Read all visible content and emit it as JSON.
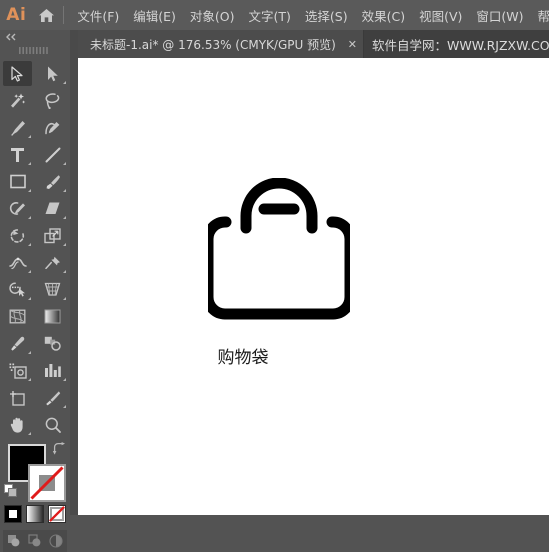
{
  "app": {
    "logo_text": "Ai",
    "home_icon": "home-icon"
  },
  "menubar": {
    "items": [
      {
        "label": "文件(F)"
      },
      {
        "label": "编辑(E)"
      },
      {
        "label": "对象(O)"
      },
      {
        "label": "文字(T)"
      },
      {
        "label": "选择(S)"
      },
      {
        "label": "效果(C)"
      },
      {
        "label": "视图(V)"
      },
      {
        "label": "窗口(W)"
      },
      {
        "label": "帮助"
      }
    ]
  },
  "tabbar": {
    "document_tab": {
      "title": "未标题-1.ai* @ 176.53% (CMYK/GPU 预览)",
      "close_label": "✕"
    },
    "watermark": "软件自学网：WWW.RJZXW.COM"
  },
  "toolbar": {
    "collapse_label": "◀◀",
    "tools": [
      {
        "name": "selection-tool",
        "selected": true,
        "corner": false
      },
      {
        "name": "direct-selection-tool",
        "selected": false,
        "corner": true
      },
      {
        "name": "magic-wand-tool",
        "selected": false,
        "corner": false
      },
      {
        "name": "lasso-tool",
        "selected": false,
        "corner": false
      },
      {
        "name": "pen-tool",
        "selected": false,
        "corner": true
      },
      {
        "name": "curvature-tool",
        "selected": false,
        "corner": false
      },
      {
        "name": "type-tool",
        "selected": false,
        "corner": true
      },
      {
        "name": "line-segment-tool",
        "selected": false,
        "corner": true
      },
      {
        "name": "rectangle-tool",
        "selected": false,
        "corner": true
      },
      {
        "name": "paintbrush-tool",
        "selected": false,
        "corner": true
      },
      {
        "name": "shaper-tool",
        "selected": false,
        "corner": true
      },
      {
        "name": "eraser-tool",
        "selected": false,
        "corner": true
      },
      {
        "name": "rotate-tool",
        "selected": false,
        "corner": true
      },
      {
        "name": "scale-tool",
        "selected": false,
        "corner": true
      },
      {
        "name": "width-tool",
        "selected": false,
        "corner": true
      },
      {
        "name": "free-transform-tool",
        "selected": false,
        "corner": true
      },
      {
        "name": "shape-builder-tool",
        "selected": false,
        "corner": true
      },
      {
        "name": "perspective-grid-tool",
        "selected": false,
        "corner": true
      },
      {
        "name": "mesh-tool",
        "selected": false,
        "corner": false
      },
      {
        "name": "gradient-tool",
        "selected": false,
        "corner": false
      },
      {
        "name": "eyedropper-tool",
        "selected": false,
        "corner": true
      },
      {
        "name": "blend-tool",
        "selected": false,
        "corner": false
      },
      {
        "name": "symbol-sprayer-tool",
        "selected": false,
        "corner": true
      },
      {
        "name": "column-graph-tool",
        "selected": false,
        "corner": true
      },
      {
        "name": "artboard-tool",
        "selected": false,
        "corner": false
      },
      {
        "name": "slice-tool",
        "selected": false,
        "corner": true
      },
      {
        "name": "hand-tool",
        "selected": false,
        "corner": true
      },
      {
        "name": "zoom-tool",
        "selected": false,
        "corner": false
      }
    ],
    "colors": {
      "fill": "#000000",
      "stroke": "#ffffff",
      "none_slash": "#e01b1b"
    },
    "paint_modes": [
      {
        "name": "color-mode-button",
        "active": false
      },
      {
        "name": "gradient-mode-button",
        "active": false
      },
      {
        "name": "none-mode-button",
        "active": true
      }
    ],
    "draw_modes": [
      {
        "name": "draw-normal-button",
        "active": true
      },
      {
        "name": "draw-behind-button",
        "active": false
      },
      {
        "name": "draw-inside-button",
        "active": false
      }
    ]
  },
  "canvas": {
    "artwork_name": "shopping-bag-artwork",
    "label": "购物袋",
    "fill_color": "#000000",
    "background": "#ffffff"
  }
}
